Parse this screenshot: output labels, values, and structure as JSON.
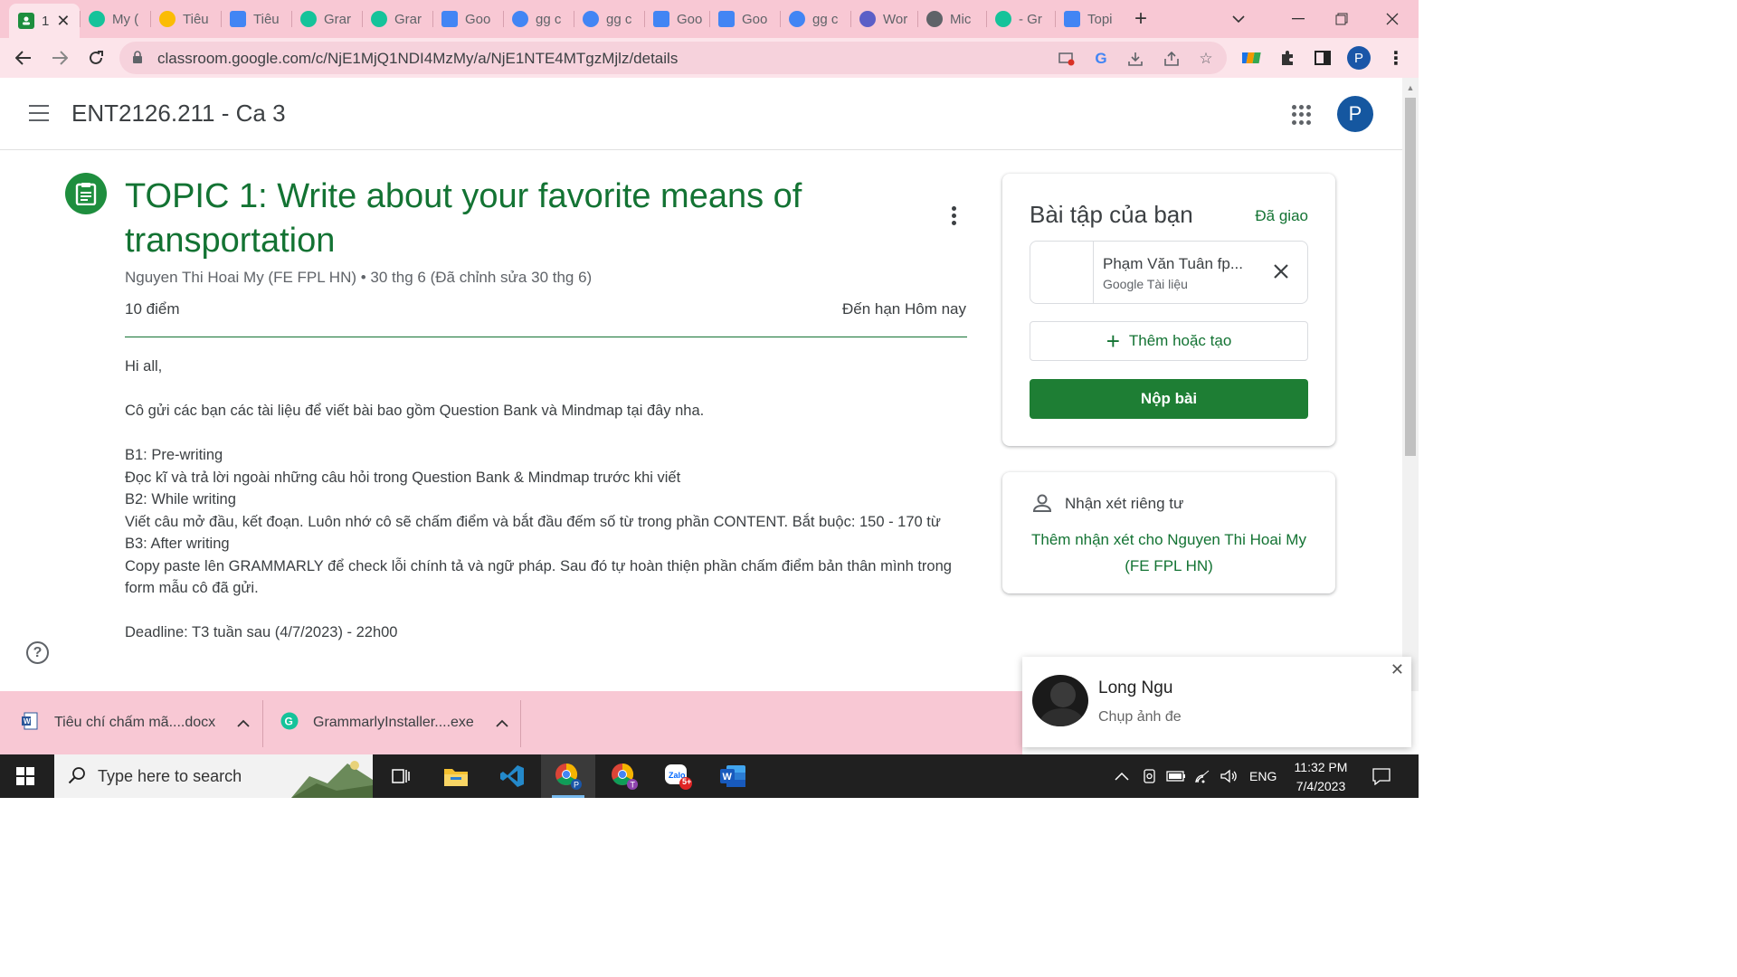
{
  "browser": {
    "tabs": [
      {
        "label": "1",
        "favicon_color": "#1e8e3e",
        "favicon": "classroom-icon",
        "active": true
      },
      {
        "label": "My (",
        "favicon_color": "#15c39a",
        "favicon": "grammarly-icon"
      },
      {
        "label": "Tiêu",
        "favicon_color": "#fbbc04",
        "favicon": "drive-icon"
      },
      {
        "label": "Tiêu",
        "favicon_color": "#4285f4",
        "favicon": "docs-icon"
      },
      {
        "label": "Grar",
        "favicon_color": "#15c39a",
        "favicon": "grammarly-icon"
      },
      {
        "label": "Grar",
        "favicon_color": "#15c39a",
        "favicon": "grammarly-icon"
      },
      {
        "label": "Goo",
        "favicon_color": "#4285f4",
        "favicon": "translate-icon"
      },
      {
        "label": "gg c",
        "favicon_color": "#4285f4",
        "favicon": "google-icon"
      },
      {
        "label": "gg c",
        "favicon_color": "#4285f4",
        "favicon": "google-icon"
      },
      {
        "label": "Goo",
        "favicon_color": "#4285f4",
        "favicon": "translate-icon"
      },
      {
        "label": "Goo",
        "favicon_color": "#4285f4",
        "favicon": "translate-icon"
      },
      {
        "label": "gg c",
        "favicon_color": "#4285f4",
        "favicon": "google-icon"
      },
      {
        "label": "Wor",
        "favicon_color": "#5b5fc7",
        "favicon": "copilot-icon"
      },
      {
        "label": "Mic",
        "favicon_color": "#5f6368",
        "favicon": "globe-icon"
      },
      {
        "label": "- Gr",
        "favicon_color": "#15c39a",
        "favicon": "grammarly-icon"
      },
      {
        "label": "Topi",
        "favicon_color": "#4285f4",
        "favicon": "docs-icon"
      }
    ],
    "new_tab": "+",
    "url": "classroom.google.com/c/NjE1MjQ1NDI4MzMy/a/NjE1NTE4MTgzMjlz/details",
    "profile_initial": "P"
  },
  "header": {
    "class_title": "ENT2126.211 - Ca 3",
    "avatar_initial": "P"
  },
  "assignment": {
    "title": "TOPIC 1: Write about your favorite means of transportation",
    "meta": "Nguyen Thi Hoai My (FE FPL HN) • 30 thg 6 (Đã chỉnh sửa 30 thg 6)",
    "points": "10 điểm",
    "due": "Đến hạn Hôm nay",
    "body": [
      "Hi all,",
      "",
      "Cô gửi các bạn các tài liệu để viết bài bao gồm Question Bank và Mindmap tại đây nha.",
      "",
      "B1: Pre-writing",
      "Đọc kĩ và trả lời ngoài những câu hỏi trong Question Bank & Mindmap trước khi viết",
      "B2: While writing",
      "Viết câu mở đầu, kết đoạn. Luôn nhớ cô sẽ chấm điểm và bắt đầu đếm số từ trong phần CONTENT. Bắt buộc: 150 - 170 từ",
      "B3: After writing",
      "Copy paste lên GRAMMARLY để check lỗi chính tả và ngữ pháp. Sau đó tự hoàn thiện phần chấm điểm bản thân mình trong form mẫu cô đã gửi.",
      "",
      "Deadline: T3 tuần sau (4/7/2023) - 22h00"
    ]
  },
  "your_work": {
    "title": "Bài tập của bạn",
    "status": "Đã giao",
    "attachment_name": "Phạm Văn Tuân fp...",
    "attachment_type": "Google Tài liệu",
    "add_label": "Thêm hoặc tạo",
    "submit_label": "Nộp bài"
  },
  "private_comments": {
    "title": "Nhận xét riêng tư",
    "link": "Thêm nhận xét cho Nguyen Thi Hoai My (FE FPL HN)"
  },
  "help": "?",
  "notification": {
    "name": "Long Ngu",
    "message": "Chụp ảnh đe"
  },
  "downloads": [
    {
      "name": "Tiêu chí chấm mã....docx",
      "icon": "word-doc-icon"
    },
    {
      "name": "GrammarlyInstaller....exe",
      "icon": "grammarly-icon"
    }
  ],
  "taskbar": {
    "search_placeholder": "Type here to search",
    "language": "ENG",
    "time": "11:32 PM",
    "date": "7/4/2023",
    "zalo_badge": "5+"
  },
  "colors": {
    "classroom_green": "#137333",
    "browser_pink": "#f8c8d4",
    "submit_green": "#1e7e34"
  }
}
